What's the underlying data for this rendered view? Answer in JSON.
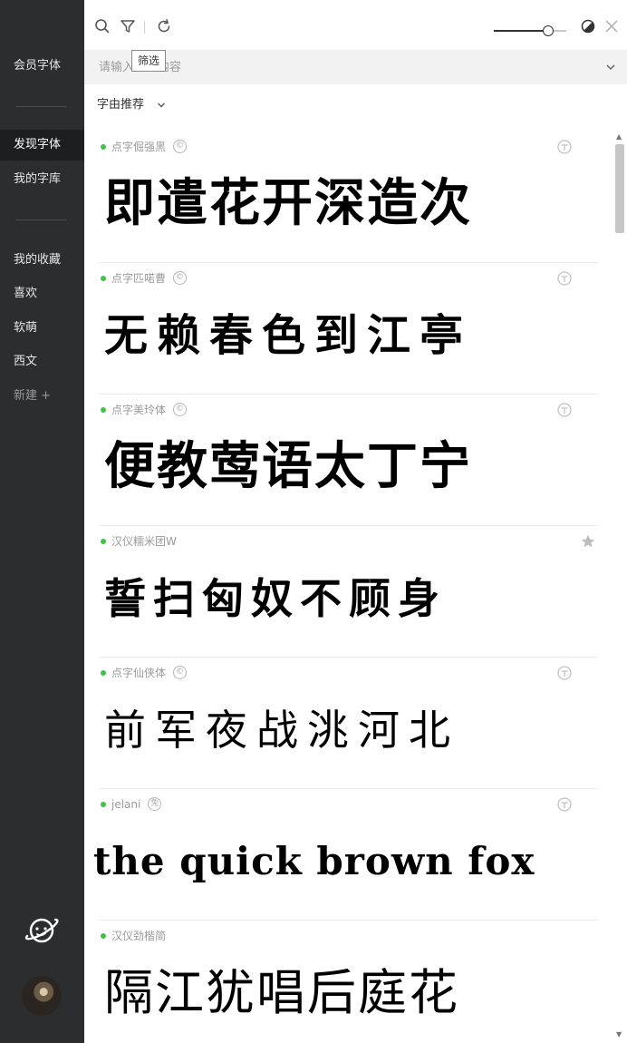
{
  "sidebar": {
    "vip_fonts": "会员字体",
    "discover": "发现字体",
    "my_library": "我的字库",
    "favorites": "我的收藏",
    "collections": [
      "喜欢",
      "软萌",
      "西文"
    ],
    "new_collection": "新建 +"
  },
  "toolbar": {
    "tooltip": "筛选",
    "size_slider_value": 0.75
  },
  "search": {
    "placeholder": "请输入搜索内容"
  },
  "sort": {
    "label": "字由推荐"
  },
  "fonts": [
    {
      "name": "点字倔强黑",
      "license": "©",
      "sample": "即遣花开深造次"
    },
    {
      "name": "点字匹喏曹",
      "license": "©",
      "sample": "无赖春色到江亭"
    },
    {
      "name": "点字美玲体",
      "license": "©",
      "sample": "便教莺语太丁宁"
    },
    {
      "name": "汉仪糯米团W",
      "license": "",
      "sample": "誓扫匈奴不顾身"
    },
    {
      "name": "点字仙侠体",
      "license": "©",
      "sample": "前军夜战洮河北"
    },
    {
      "name": "jelani",
      "license": "免",
      "sample": "the quick brown fox"
    },
    {
      "name": "汉仪劲楷简",
      "license": "",
      "sample": "隔江犹唱后庭花"
    }
  ],
  "colors": {
    "sidebar_bg": "#2b2d2e",
    "active_bg": "#1d1e1f",
    "status_dot": "#3dc447"
  }
}
